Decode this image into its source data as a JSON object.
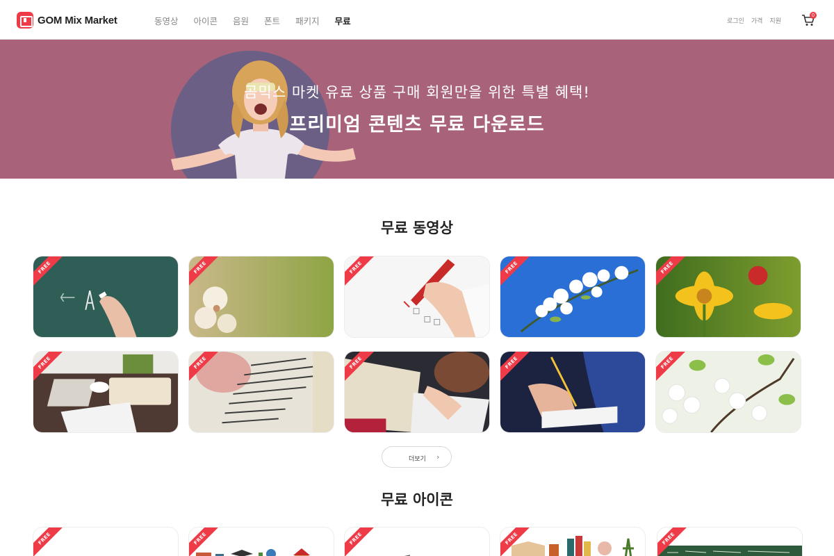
{
  "header": {
    "logo_text": "GOM Mix Market",
    "nav": [
      "동영상",
      "아이콘",
      "음원",
      "폰트",
      "패키지",
      "무료"
    ],
    "active_nav": "무료",
    "util": [
      "로그인",
      "가격",
      "지원"
    ],
    "cart_count": "0"
  },
  "banner": {
    "subtitle": "곰믹스 마켓 유료 상품 구매 회원만을 위한 특별 혜택!",
    "title": "프리미엄 콘텐츠 무료 다운로드",
    "bg_color": "#a8637a"
  },
  "free_videos": {
    "title": "무료 동영상",
    "badge": "FREE",
    "more_label": "더보기"
  },
  "free_icons": {
    "title": "무료 아이콘",
    "badge": "FREE"
  },
  "colors": {
    "accent": "#ef3b47",
    "banner": "#a8637a"
  }
}
